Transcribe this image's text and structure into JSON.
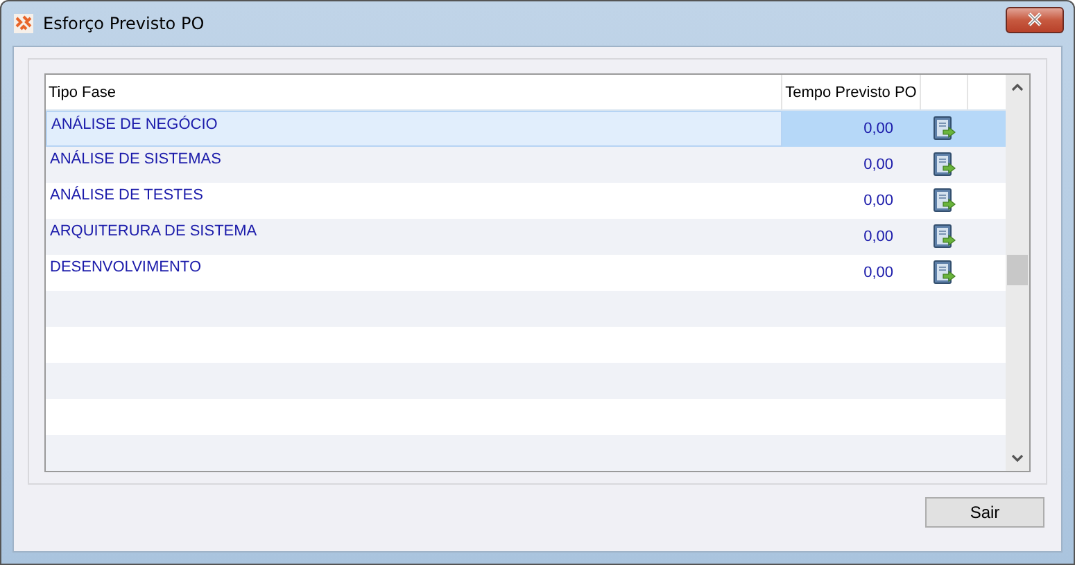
{
  "window": {
    "title": "Esforço Previsto PO"
  },
  "table": {
    "columns": [
      "Tipo Fase",
      "Tempo Previsto PO"
    ],
    "rows": [
      {
        "tipo_fase": "ANÁLISE DE NEGÓCIO",
        "tempo": "0,00",
        "selected": true
      },
      {
        "tipo_fase": "ANÁLISE DE SISTEMAS",
        "tempo": "0,00",
        "selected": false
      },
      {
        "tipo_fase": "ANÁLISE DE TESTES",
        "tempo": "0,00",
        "selected": false
      },
      {
        "tipo_fase": "ARQUITERURA DE SISTEMA",
        "tempo": "0,00",
        "selected": false
      },
      {
        "tipo_fase": "DESENVOLVIMENTO",
        "tempo": "0,00",
        "selected": false
      }
    ]
  },
  "buttons": [
    "Sair"
  ]
}
